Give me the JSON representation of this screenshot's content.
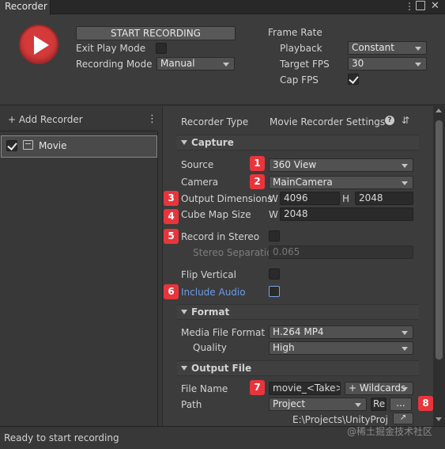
{
  "window": {
    "tab_title": "Recorder"
  },
  "header": {
    "start_label": "START RECORDING",
    "exit_play_mode_label": "Exit Play Mode",
    "exit_play_mode_checked": false,
    "recording_mode_label": "Recording Mode",
    "recording_mode_value": "Manual",
    "frame_rate_label": "Frame Rate",
    "playback_label": "Playback",
    "playback_value": "Constant",
    "target_fps_label": "Target FPS",
    "target_fps_value": "30",
    "cap_fps_label": "Cap FPS",
    "cap_fps_checked": true
  },
  "left": {
    "add_recorder_label": "+ Add Recorder",
    "menu_icon": "⋮",
    "recorders": [
      {
        "label": "Movie",
        "enabled": true
      }
    ]
  },
  "inspector": {
    "recorder_type_label": "Recorder Type",
    "recorder_type_value": "Movie Recorder Settings",
    "capture_title": "Capture",
    "source_label": "Source",
    "source_value": "360 View",
    "camera_label": "Camera",
    "camera_value": "MainCamera",
    "output_dimensions_label": "Output Dimensions",
    "w_label": "W",
    "width_value": "4096",
    "h_label": "H",
    "height_value": "2048",
    "cube_map_label": "Cube Map Size",
    "cube_w_label": "W",
    "cube_map_value": "2048",
    "record_in_stereo_label": "Record in Stereo",
    "stereo_sep_label": "Stereo Separatio",
    "stereo_sep_value": "0.065",
    "flip_vertical_label": "Flip Vertical",
    "include_audio_label": "Include Audio",
    "format_title": "Format",
    "media_format_label": "Media File Format",
    "media_format_value": "H.264 MP4",
    "quality_label": "Quality",
    "quality_value": "High",
    "output_file_title": "Output File",
    "file_name_label": "File Name",
    "file_name_value": "movie_<Take>",
    "wildcards_label": "+ Wildcards",
    "path_label": "Path",
    "path_value": "Project",
    "path_extra": "Re",
    "browse_label": "...",
    "path_full": "E:\\Projects\\UnityProj"
  },
  "badges": [
    "1",
    "2",
    "3",
    "4",
    "5",
    "6",
    "7",
    "8"
  ],
  "status": {
    "text": "Ready to start recording"
  },
  "watermark": "@稀土掘金技术社区"
}
